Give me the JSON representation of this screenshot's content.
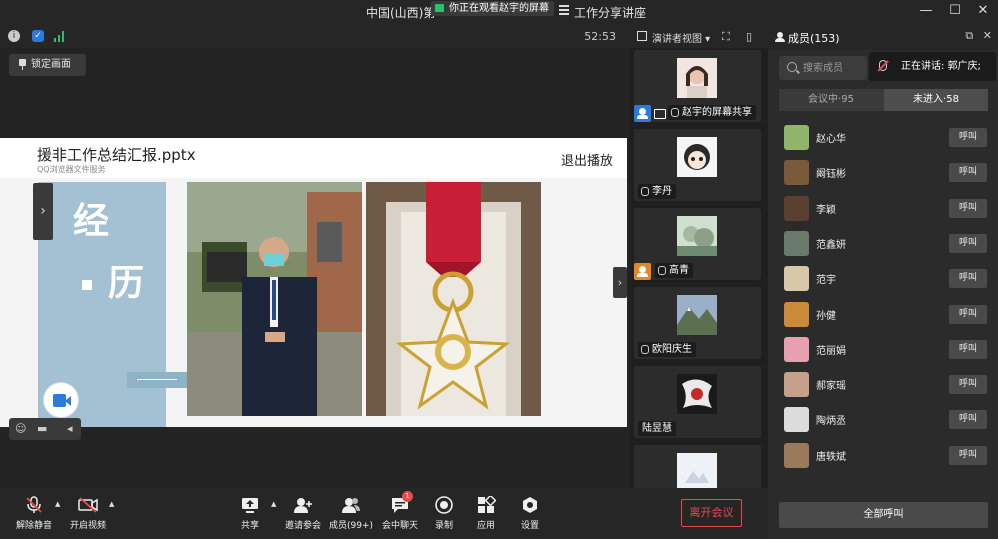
{
  "window": {
    "title_left": "中国(山西)第",
    "watching_banner": "你正在观看赵宇的屏幕",
    "title_right": "工作分享讲座",
    "minimize": "—",
    "maximize": "☐",
    "close": "✕"
  },
  "infobar": {
    "timer": "52:53"
  },
  "stage": {
    "lock_label": "锁定画面",
    "doc_title": "援非工作总结汇报.pptx",
    "doc_subtitle": "QQ浏览器文件服务",
    "exit_label": "退出播放",
    "slide_char1": "经",
    "slide_char2": "历"
  },
  "gallery": {
    "view_label": "演讲者视图",
    "tiles": [
      {
        "name": "赵宇的屏幕共享"
      },
      {
        "name": "李丹"
      },
      {
        "name": "高青"
      },
      {
        "name": "欧阳庆生"
      },
      {
        "name": "陆昱慧"
      },
      {
        "name": ""
      }
    ]
  },
  "members": {
    "header": "成员(153)",
    "search_placeholder": "搜索成员",
    "speaking": "正在讲话: 郭广庆;",
    "tab_in_meeting": "会议中·95",
    "tab_not_joined": "未进入·58",
    "call_label": "呼叫",
    "list": [
      {
        "name": "赵心华",
        "color": "#8fb56a"
      },
      {
        "name": "阚钰彬",
        "color": "#7a5a3a"
      },
      {
        "name": "李颖",
        "color": "#5a4030"
      },
      {
        "name": "范鑫妍",
        "color": "#6a7a6a"
      },
      {
        "name": "范宇",
        "color": "#d8c7a8"
      },
      {
        "name": "孙健",
        "color": "#c98a3a"
      },
      {
        "name": "范丽娟",
        "color": "#e8a0b0"
      },
      {
        "name": "郝家瑶",
        "color": "#c6a08a"
      },
      {
        "name": "陶炳丞",
        "color": "#dcdcdc"
      },
      {
        "name": "唐轶斌",
        "color": "#9a7a5a"
      }
    ],
    "call_all": "全部呼叫"
  },
  "toolbar": {
    "unmute": "解除静音",
    "start_video": "开启视频",
    "share": "共享",
    "invite": "邀请参会",
    "members": "成员(99+)",
    "chat": "会中聊天",
    "chat_badge": "1",
    "record": "录制",
    "apps": "应用",
    "settings": "设置",
    "leave": "离开会议"
  },
  "colors": {
    "accent_blue": "#2a7ae2",
    "danger": "#e64b4b",
    "signal_green": "#29c16b"
  }
}
